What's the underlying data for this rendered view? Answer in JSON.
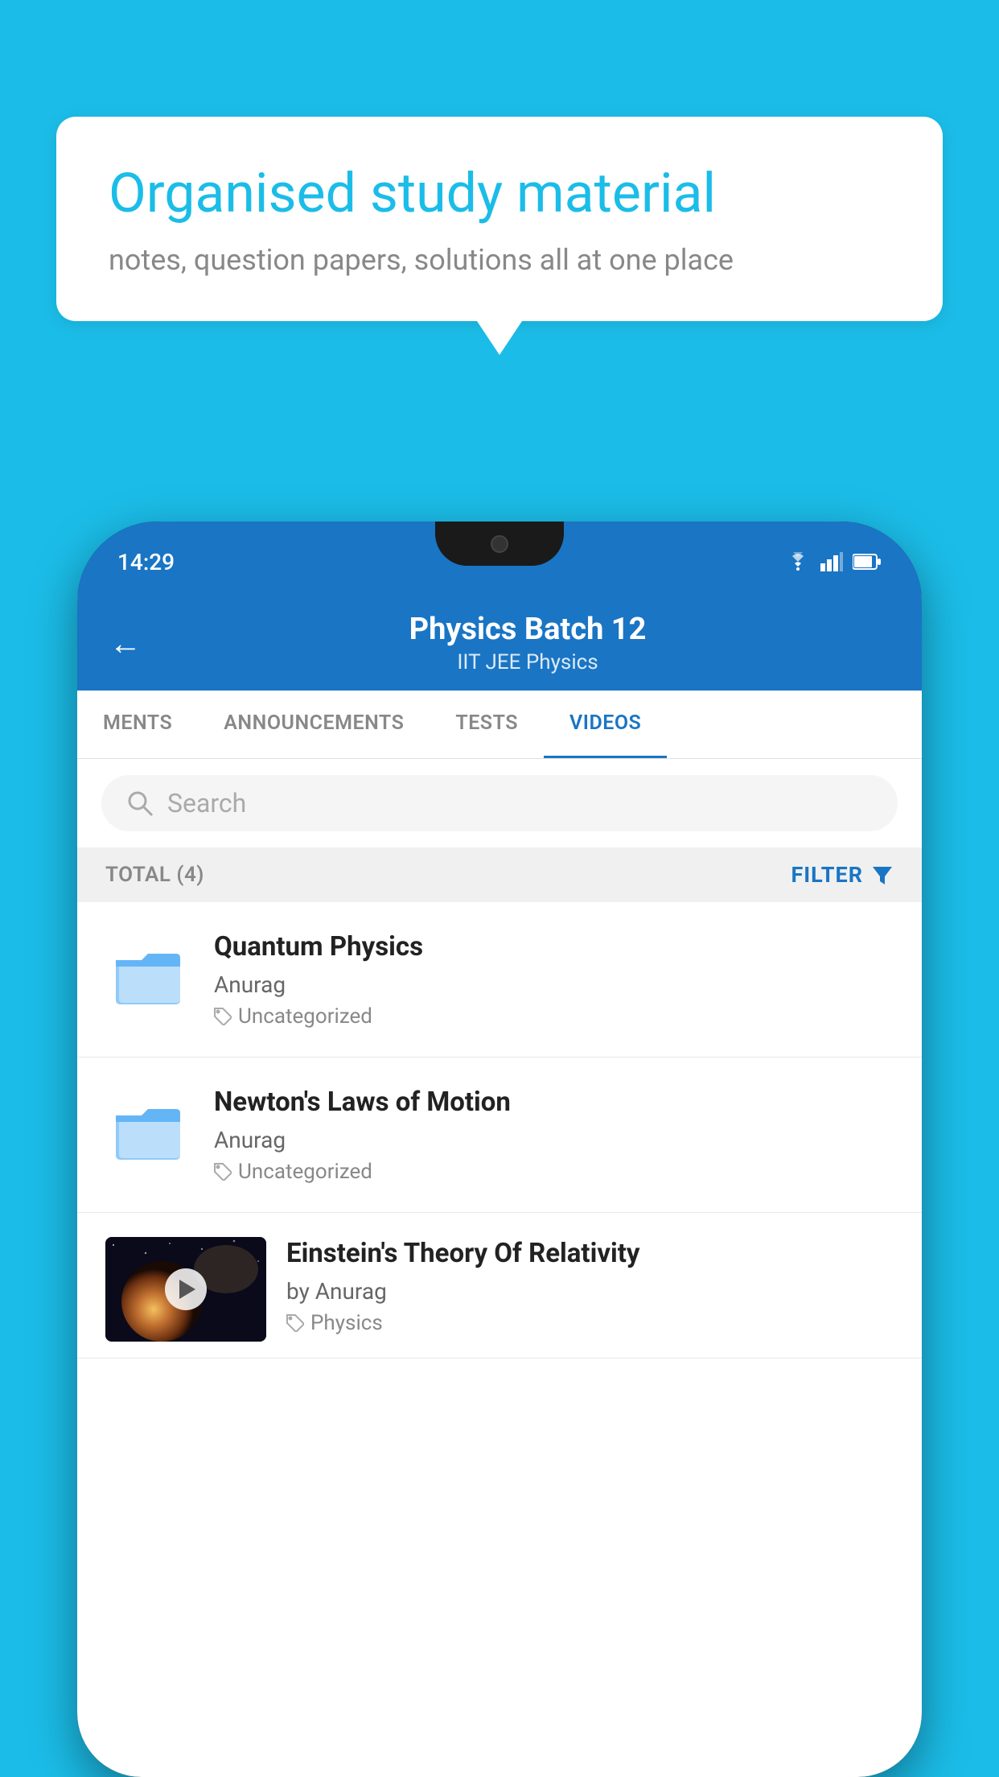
{
  "background": {
    "color": "#1BBDE8"
  },
  "speech_bubble": {
    "title": "Organised study material",
    "subtitle": "notes, question papers, solutions all at one place"
  },
  "status_bar": {
    "time": "14:29",
    "icons": [
      "wifi",
      "signal",
      "battery"
    ]
  },
  "app_header": {
    "back_label": "←",
    "title": "Physics Batch 12",
    "subtitle": "IIT JEE   Physics"
  },
  "tabs": [
    {
      "label": "MENTS",
      "active": false
    },
    {
      "label": "ANNOUNCEMENTS",
      "active": false
    },
    {
      "label": "TESTS",
      "active": false
    },
    {
      "label": "VIDEOS",
      "active": true
    }
  ],
  "search": {
    "placeholder": "Search"
  },
  "filter_bar": {
    "total_label": "TOTAL (4)",
    "filter_label": "FILTER"
  },
  "videos": [
    {
      "title": "Quantum Physics",
      "author": "Anurag",
      "tag": "Uncategorized",
      "has_thumb": false
    },
    {
      "title": "Newton's Laws of Motion",
      "author": "Anurag",
      "tag": "Uncategorized",
      "has_thumb": false
    },
    {
      "title": "Einstein's Theory Of Relativity",
      "author": "by Anurag",
      "tag": "Physics",
      "has_thumb": true
    }
  ]
}
